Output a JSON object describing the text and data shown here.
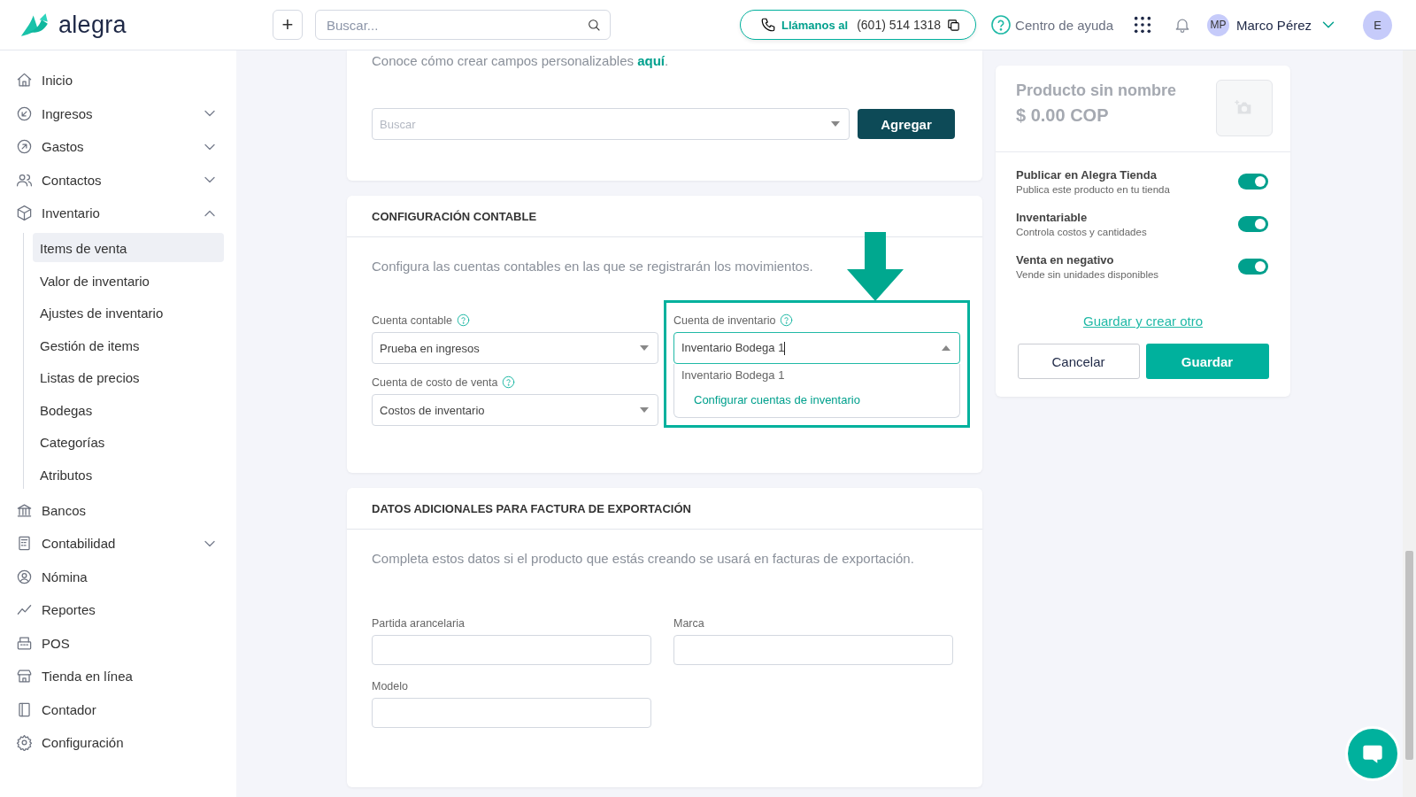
{
  "header": {
    "logo_text": "alegra",
    "add_button": "+",
    "search": {
      "placeholder": "Buscar..."
    },
    "call_button": {
      "label": "Llámanos al",
      "phone": "(601) 514 1318"
    },
    "help_link": "Centro de ayuda",
    "user": {
      "initials": "MP",
      "name": "Marco Pérez"
    },
    "account_avatar": "E"
  },
  "sidebar": {
    "items": [
      {
        "label": "Inicio",
        "expandable": false
      },
      {
        "label": "Ingresos",
        "expandable": true,
        "expanded": false
      },
      {
        "label": "Gastos",
        "expandable": true,
        "expanded": false
      },
      {
        "label": "Contactos",
        "expandable": true,
        "expanded": false
      },
      {
        "label": "Inventario",
        "expandable": true,
        "expanded": true,
        "children": [
          {
            "label": "Items de venta",
            "selected": true
          },
          {
            "label": "Valor de inventario",
            "selected": false
          },
          {
            "label": "Ajustes de inventario",
            "selected": false
          },
          {
            "label": "Gestión de items",
            "selected": false
          },
          {
            "label": "Listas de precios",
            "selected": false
          },
          {
            "label": "Bodegas",
            "selected": false
          },
          {
            "label": "Categorías",
            "selected": false
          },
          {
            "label": "Atributos",
            "selected": false
          }
        ]
      },
      {
        "label": "Bancos",
        "expandable": false
      },
      {
        "label": "Contabilidad",
        "expandable": true,
        "expanded": false
      },
      {
        "label": "Nómina",
        "expandable": false
      },
      {
        "label": "Reportes",
        "expandable": false
      },
      {
        "label": "POS",
        "expandable": false
      },
      {
        "label": "Tienda en línea",
        "expandable": false
      },
      {
        "label": "Contador",
        "expandable": false
      },
      {
        "label": "Configuración",
        "expandable": false
      }
    ]
  },
  "custom_fields_card": {
    "hint": "Conoce cómo crear campos personalizables ",
    "hint_link": "aquí",
    "hint_end": ".",
    "search_select": {
      "placeholder": "Buscar"
    },
    "add_button": "Agregar"
  },
  "accounting_card": {
    "title": "CONFIGURACIÓN CONTABLE",
    "description": "Configura las cuentas contables en las que se registrarán los movimientos.",
    "fields": [
      {
        "label": "Cuenta contable",
        "help_icon": true,
        "value": "Prueba en ingresos",
        "open": false
      },
      {
        "label": "Cuenta de inventario",
        "help_icon": true,
        "value": "Inventario Bodega 1",
        "open": true,
        "highlighted": true,
        "options": [
          "Inventario Bodega 1"
        ],
        "action": "Configurar cuentas de inventario"
      },
      {
        "label": "Cuenta de costo de venta",
        "help_icon": true,
        "value": "Costos de inventario",
        "open": false
      }
    ]
  },
  "export_card": {
    "title": "DATOS ADICIONALES PARA FACTURA DE EXPORTACIÓN",
    "description": "Completa estos datos si el producto que estás creando se usará en facturas de exportación.",
    "fields": [
      {
        "label": "Partida arancelaria"
      },
      {
        "label": "Marca"
      },
      {
        "label": "Modelo"
      }
    ]
  },
  "summary": {
    "name": "Producto sin nombre",
    "price": "$ 0.00 COP",
    "toggles": [
      {
        "title": "Publicar en Alegra Tienda",
        "subtitle": "Publica este producto en tu tienda",
        "on": true
      },
      {
        "title": "Inventariable",
        "subtitle": "Controla costos y cantidades",
        "on": true
      },
      {
        "title": "Venta en negativo",
        "subtitle": "Vende sin unidades disponibles",
        "on": true
      }
    ],
    "save_and_new_link": "Guardar y crear otro",
    "cancel_button": "Cancelar",
    "save_button": "Guardar"
  }
}
